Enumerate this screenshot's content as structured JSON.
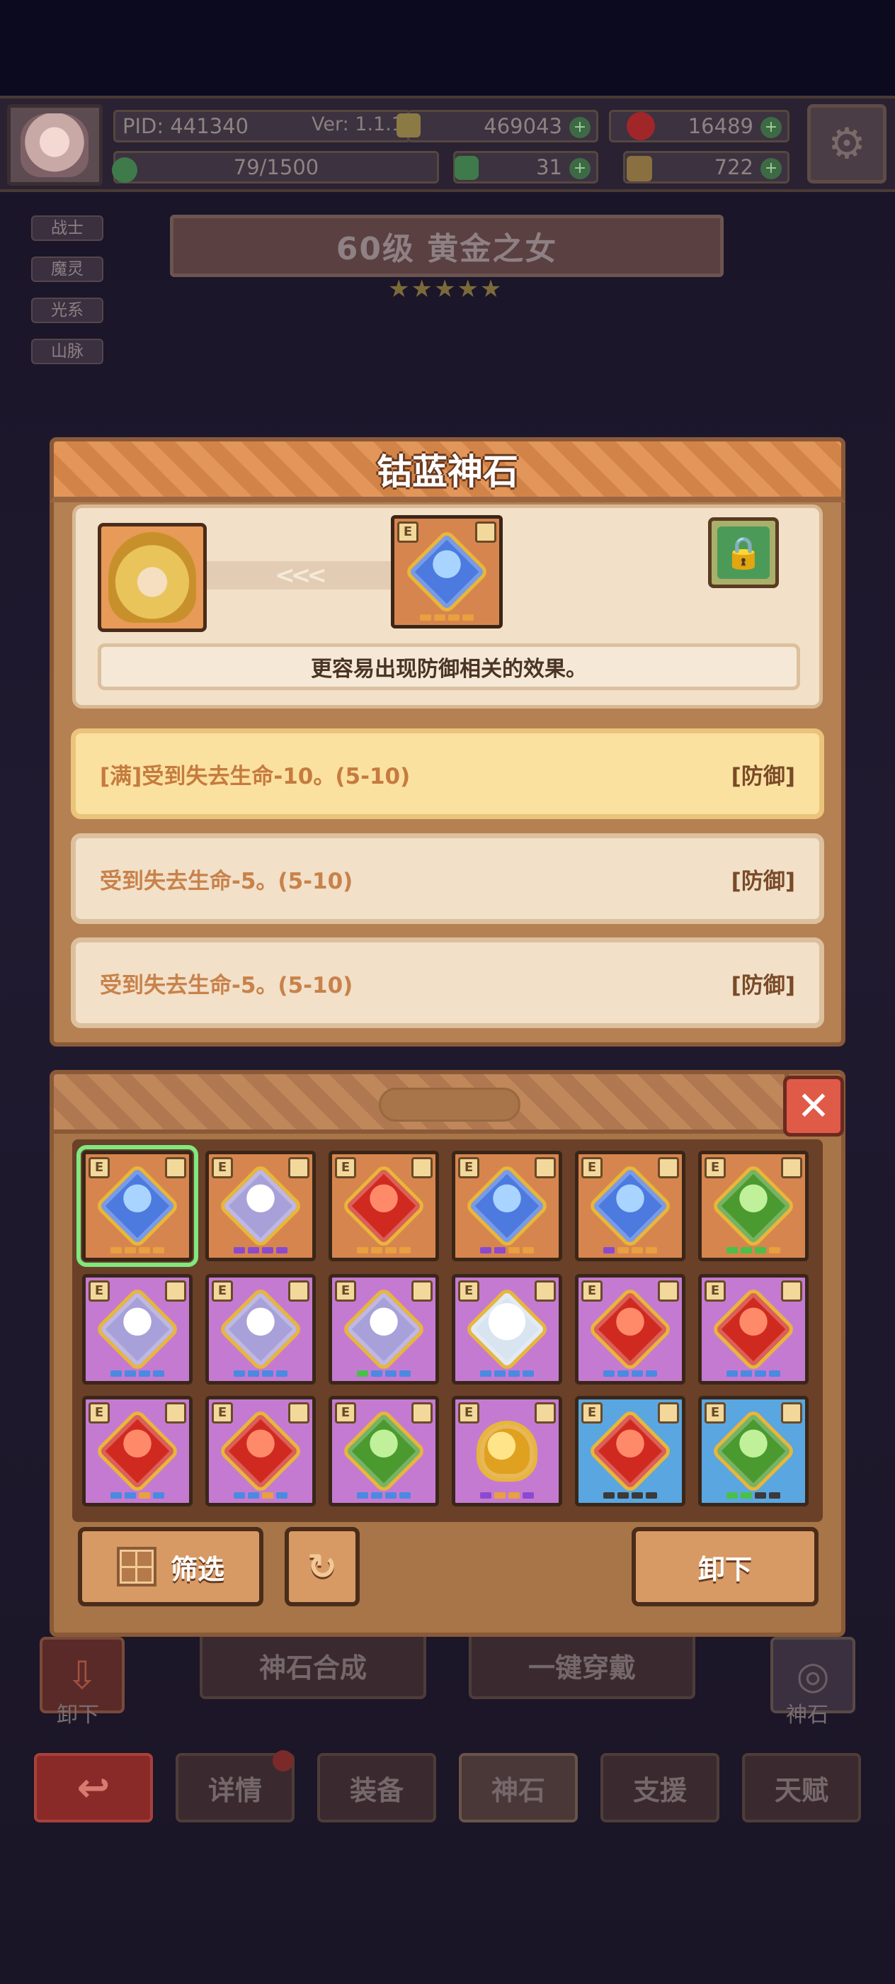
{
  "topbar": {
    "pid": "PID: 441340",
    "version": "Ver: 1.1.1.3",
    "coins": "469043",
    "gems": "16489",
    "exp": "79/1500",
    "clover": "31",
    "bag": "722"
  },
  "hero": {
    "tags": [
      "战士",
      "魔灵",
      "光系",
      "山脉"
    ],
    "title": "60级  黄金之女",
    "stars": "★★★★★"
  },
  "dialog": {
    "title": "钴蓝神石",
    "arrows": "<<<",
    "description": "更容易出现防御相关的效果。",
    "attributes": [
      {
        "text": "[满]受到失去生命-10。(5-10)",
        "tag": "[防御]"
      },
      {
        "text": "受到失去生命-5。(5-10)",
        "tag": "[防御]"
      },
      {
        "text": "受到失去生命-5。(5-10)",
        "tag": "[防御]"
      }
    ]
  },
  "inventory": {
    "badge": "E",
    "close_glyph": "✕",
    "items": [
      {
        "frame": "orange",
        "gem": "blue",
        "selected": true,
        "dots": [
          "#e8a040",
          "#e8a040",
          "#e8a040",
          "#e8a040"
        ]
      },
      {
        "frame": "orange",
        "gem": "white",
        "dots": [
          "#8a4ad0",
          "#8a4ad0",
          "#8a4ad0",
          "#8a4ad0"
        ]
      },
      {
        "frame": "orange",
        "gem": "red",
        "dots": [
          "#e8a040",
          "#e8a040",
          "#e8a040",
          "#e8a040"
        ]
      },
      {
        "frame": "orange",
        "gem": "blue",
        "dots": [
          "#8a4ad0",
          "#8a4ad0",
          "#e8a040",
          "#e8a040"
        ]
      },
      {
        "frame": "orange",
        "gem": "blue",
        "dots": [
          "#8a4ad0",
          "#e8a040",
          "#e8a040",
          "#e8a040"
        ]
      },
      {
        "frame": "orange",
        "gem": "green",
        "dots": [
          "#4ac04a",
          "#4ac04a",
          "#4ac04a",
          "#e8a040"
        ]
      },
      {
        "frame": "purple",
        "gem": "white",
        "dots": [
          "#4a8ae0",
          "#4a8ae0",
          "#4a8ae0",
          "#4a8ae0"
        ]
      },
      {
        "frame": "purple",
        "gem": "white",
        "dots": [
          "#4a8ae0",
          "#4a8ae0",
          "#4a8ae0",
          "#4a8ae0"
        ]
      },
      {
        "frame": "purple",
        "gem": "white",
        "dots": [
          "#4ac04a",
          "#4a8ae0",
          "#4a8ae0",
          "#4a8ae0"
        ]
      },
      {
        "frame": "purple",
        "gem": "clear",
        "dots": [
          "#4a8ae0",
          "#4a8ae0",
          "#4a8ae0",
          "#4a8ae0"
        ]
      },
      {
        "frame": "purple",
        "gem": "red",
        "dots": [
          "#4a8ae0",
          "#4a8ae0",
          "#4a8ae0",
          "#4a8ae0"
        ]
      },
      {
        "frame": "purple",
        "gem": "red",
        "dots": [
          "#4a8ae0",
          "#4a8ae0",
          "#4a8ae0",
          "#4a8ae0"
        ]
      },
      {
        "frame": "purple",
        "gem": "red",
        "dots": [
          "#4a8ae0",
          "#4a8ae0",
          "#e8a040",
          "#4a8ae0"
        ]
      },
      {
        "frame": "purple",
        "gem": "red",
        "dots": [
          "#4a8ae0",
          "#4a8ae0",
          "#e8a040",
          "#4a8ae0"
        ]
      },
      {
        "frame": "purple",
        "gem": "green",
        "dots": [
          "#4a8ae0",
          "#4a8ae0",
          "#4a8ae0",
          "#4a8ae0"
        ]
      },
      {
        "frame": "purple",
        "gem": "heart",
        "dots": [
          "#8a4ad0",
          "#e8a040",
          "#e8a040",
          "#8a4ad0"
        ]
      },
      {
        "frame": "blue",
        "gem": "red",
        "dots": [
          "#3a3a3a",
          "#3a3a3a",
          "#3a3a3a",
          "#3a3a3a"
        ]
      },
      {
        "frame": "blue",
        "gem": "green",
        "dots": [
          "#4ac04a",
          "#4ac04a",
          "#3a3a3a",
          "#3a3a3a"
        ]
      }
    ],
    "filter_label": "筛选",
    "unload_label": "卸下"
  },
  "background": {
    "synth_label": "神石合成",
    "equip_all_label": "一键穿戴",
    "left_side_label": "卸下",
    "right_side_label": "神石",
    "tabs": [
      "详情",
      "装备",
      "神石",
      "支援",
      "天赋"
    ]
  }
}
